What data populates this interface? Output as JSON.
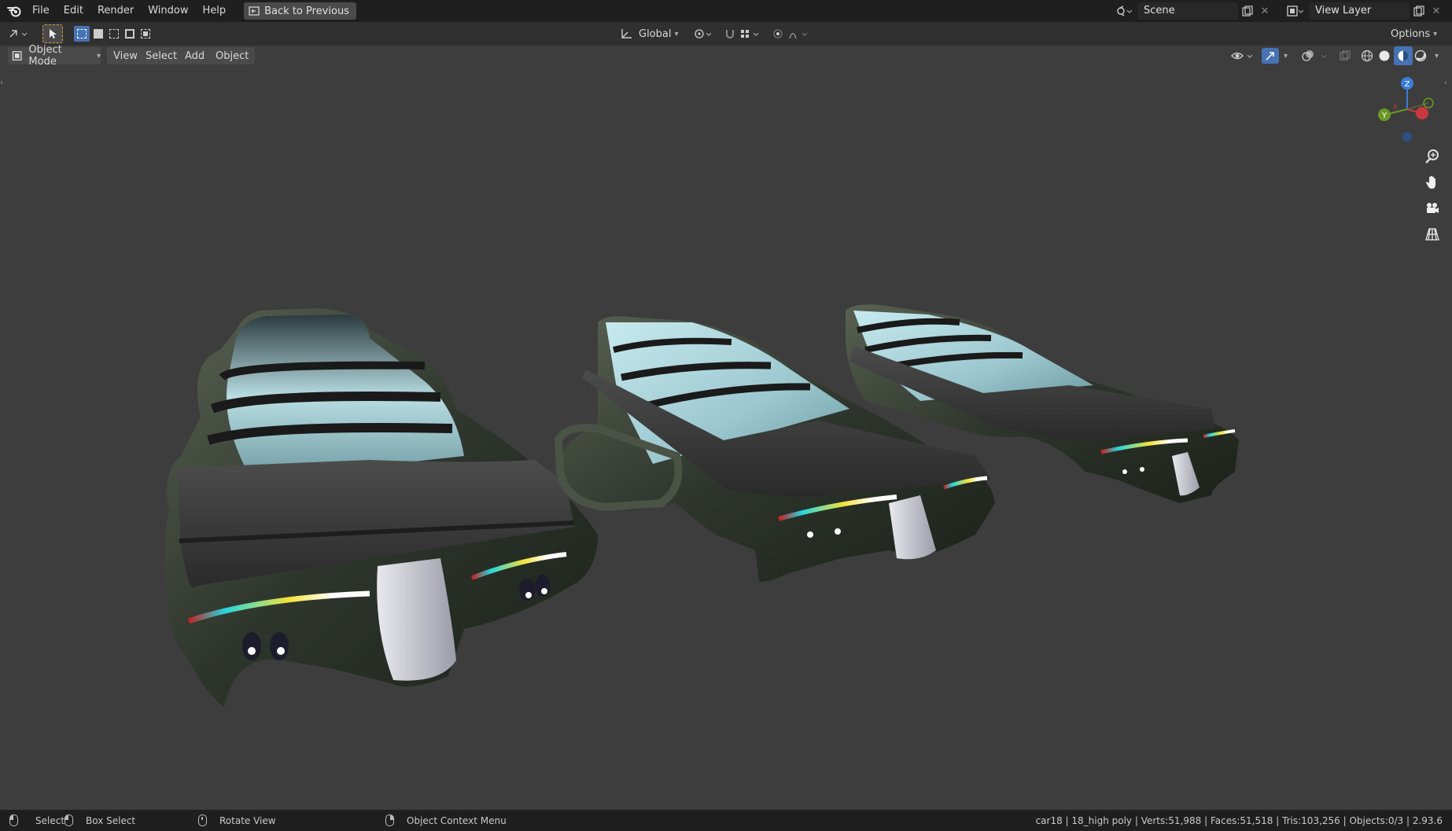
{
  "topbar": {
    "menus": [
      "File",
      "Edit",
      "Render",
      "Window",
      "Help"
    ],
    "back_button": "Back to Previous",
    "scene_name": "Scene",
    "view_layer_name": "View Layer"
  },
  "toolheader": {
    "orientation": "Global",
    "options_label": "Options"
  },
  "viewheader": {
    "mode": "Object Mode",
    "menus": [
      "View",
      "Select",
      "Add",
      "Object"
    ]
  },
  "gizmo": {
    "axes": [
      "Z",
      "Y",
      "X"
    ]
  },
  "statusbar": {
    "select": "Select",
    "box_select": "Box Select",
    "rotate_view": "Rotate View",
    "context_menu": "Object Context Menu",
    "stats": "car18 | 18_high poly | Verts:51,988 | Faces:51,518 | Tris:103,256 | Objects:0/3 | 2.93.6"
  },
  "colors": {
    "background": "#3d3d3d",
    "header": "#1f1f1f",
    "toolheader": "#303030",
    "accent_blue": "#4772b3",
    "axis_x": "#c8383e",
    "axis_y": "#6a9a26",
    "axis_z": "#3b7dd8"
  },
  "icons": [
    "blender-logo-icon",
    "back-icon",
    "scene-icon",
    "new-scene-icon",
    "close-icon",
    "view-layer-icon",
    "editor-type-icon",
    "select-tool-icon",
    "transform-orientation-icon",
    "pivot-icon",
    "snap-icon",
    "proportional-edit-icon",
    "visibility-icon",
    "gizmo-icon",
    "overlay-icon",
    "xray-icon",
    "wireframe-shading-icon",
    "solid-shading-icon",
    "material-shading-icon",
    "rendered-shading-icon",
    "zoom-icon",
    "pan-hand-icon",
    "camera-view-icon",
    "grid-perspective-icon",
    "mouse-left-icon",
    "mouse-right-icon",
    "mouse-middle-icon"
  ]
}
